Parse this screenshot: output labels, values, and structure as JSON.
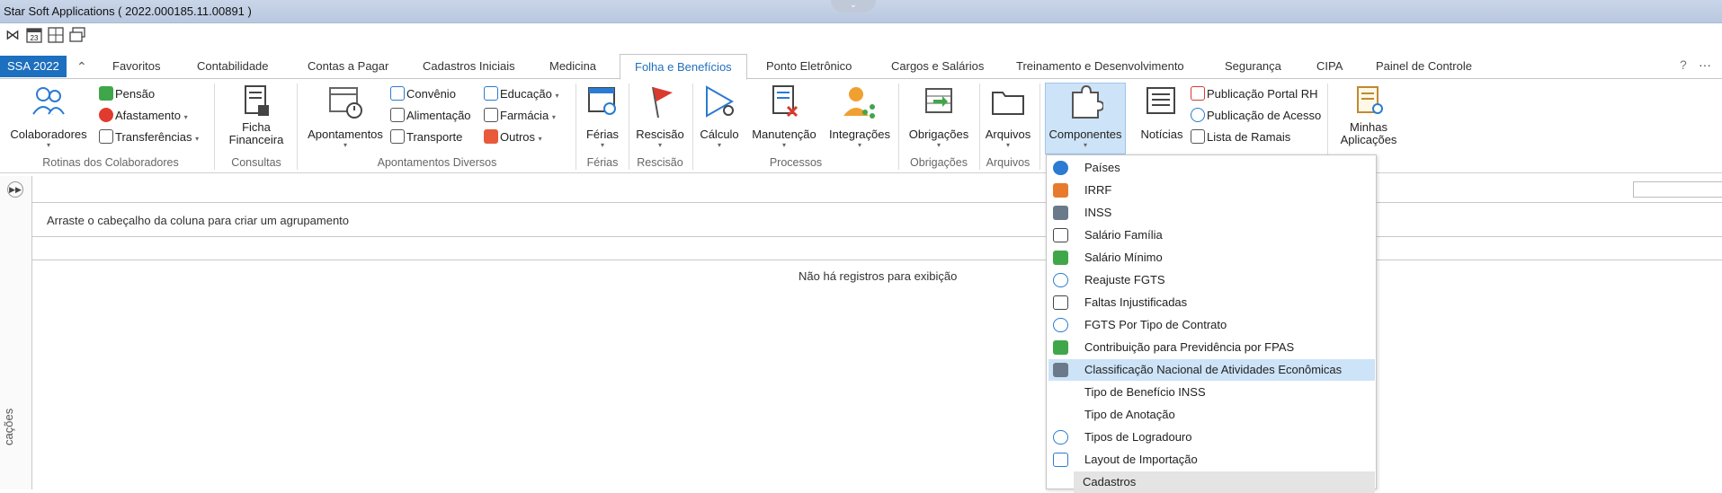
{
  "window": {
    "title": "Star Soft Applications ( 2022.000185.11.00891 )"
  },
  "quick_access": {
    "icons": [
      "collapse-icon",
      "calendar-icon",
      "grid-icon",
      "windows-icon"
    ],
    "calendar_day": "23"
  },
  "tabs": {
    "app_button": "SSA 2022",
    "items": [
      "Favoritos",
      "Contabilidade",
      "Contas a Pagar",
      "Cadastros Iniciais",
      "Medicina",
      "Folha e Benefícios",
      "Ponto Eletrônico",
      "Cargos e Salários",
      "Treinamento e Desenvolvimento",
      "Segurança",
      "CIPA",
      "Painel de Controle"
    ],
    "active": "Folha e Benefícios",
    "help": "?",
    "more": "···"
  },
  "ribbon": {
    "colaboradores": "Colaboradores",
    "pensao": "Pensão",
    "afastamento": "Afastamento",
    "transferencias": "Transferências",
    "group_rotinas": "Rotinas dos Colaboradores",
    "ficha_1": "Ficha",
    "ficha_2": "Financeira",
    "group_consultas": "Consultas",
    "apontamentos": "Apontamentos",
    "convenio": "Convênio",
    "alimentacao": "Alimentação",
    "transporte": "Transporte",
    "educacao": "Educação",
    "farmacia": "Farmácia",
    "outros": "Outros",
    "group_apontamentos": "Apontamentos Diversos",
    "ferias": "Férias",
    "group_ferias": "Férias",
    "rescisao": "Rescisão",
    "group_rescisao": "Rescisão",
    "calculo": "Cálculo",
    "manutencao": "Manutenção",
    "integracoes": "Integrações",
    "group_processos": "Processos",
    "obrigacoes": "Obrigações",
    "group_obrigacoes": "Obrigações",
    "arquivos": "Arquivos",
    "group_arquivos": "Arquivos",
    "componentes": "Componentes",
    "noticias": "Notícias",
    "publicacao_rh": "Publicação Portal RH",
    "publicacao_acesso": "Publicação de Acesso",
    "lista_ramais": "Lista de Ramais",
    "minhas_1": "Minhas",
    "minhas_2": "Aplicações"
  },
  "grid": {
    "group_hint": "Arraste o cabeçalho da coluna para criar um agrupamento",
    "empty": "Não há registros para exibição",
    "side_label": "cações"
  },
  "menu": {
    "items": [
      {
        "label": "Países",
        "icon": "globe-icon"
      },
      {
        "label": "IRRF",
        "icon": "tax-icon"
      },
      {
        "label": "INSS",
        "icon": "inss-icon"
      },
      {
        "label": "Salário Família",
        "icon": "family-icon"
      },
      {
        "label": "Salário Mínimo",
        "icon": "money-icon"
      },
      {
        "label": "Reajuste FGTS",
        "icon": "refresh-icon"
      },
      {
        "label": "Faltas Injustificadas",
        "icon": "calendar-icon"
      },
      {
        "label": "FGTS Por Tipo de Contrato",
        "icon": "piggy-icon"
      },
      {
        "label": "Contribuição para Previdência por FPAS",
        "icon": "contribution-icon"
      },
      {
        "label": "Classificação Nacional de Atividades Econômicas",
        "icon": "classification-icon"
      },
      {
        "label": "Tipo de Benefício INSS",
        "icon": ""
      },
      {
        "label": "Tipo de Anotação",
        "icon": ""
      },
      {
        "label": "Tipos de Logradouro",
        "icon": "location-icon"
      },
      {
        "label": "Layout de Importação",
        "icon": "csv-icon"
      },
      {
        "label": "Cadastros",
        "icon": ""
      }
    ],
    "highlighted": "Classificação Nacional de Atividades Econômicas",
    "colors": {
      "highlight": "#cde3f7",
      "accent": "#1d6fbf"
    }
  }
}
